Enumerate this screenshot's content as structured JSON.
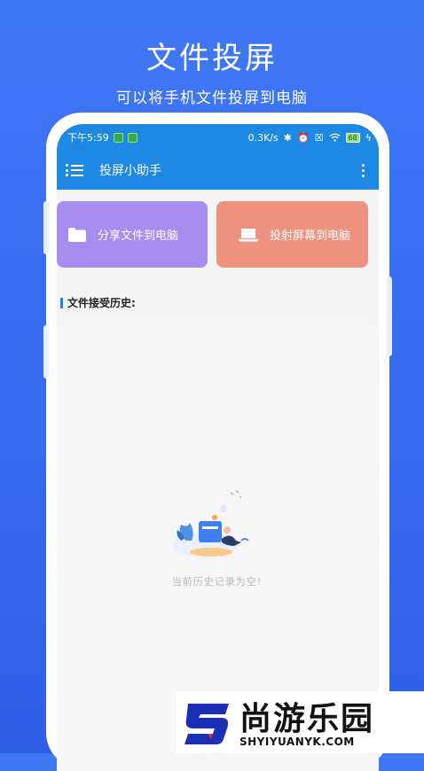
{
  "promo": {
    "title": "文件投屏",
    "subtitle": "可以将手机文件投屏到电脑"
  },
  "status_bar": {
    "time": "下午5:59",
    "network_speed": "0.3K/s",
    "battery": "68"
  },
  "app_bar": {
    "title": "投屏小助手",
    "menu_icon": "menu-icon",
    "more_icon": "more-vert-icon"
  },
  "actions": {
    "share": {
      "label": "分享文件到电脑",
      "icon": "folder-icon",
      "color": "#a88df1"
    },
    "cast": {
      "label": "投射屏幕到电脑",
      "icon": "laptop-icon",
      "color": "#ef917f"
    }
  },
  "history": {
    "title": "文件接受历史:",
    "empty_text": "当前历史记录为空!"
  },
  "watermark": {
    "name": "尚游乐园",
    "url": "SHYIYUANYK.COM"
  },
  "colors": {
    "background": "#3a70f2",
    "app_bar": "#1e88e5",
    "accent": "#1e88e5"
  }
}
